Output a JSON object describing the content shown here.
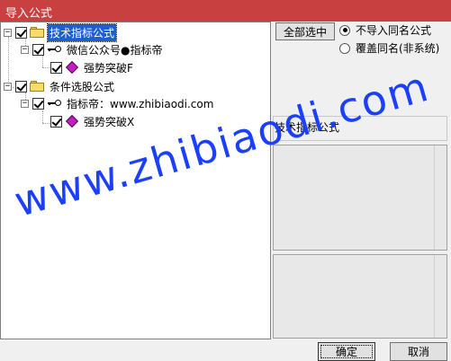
{
  "window": {
    "title": "导入公式"
  },
  "tree": {
    "nodes": [
      {
        "label": "技术指标公式",
        "expander": "−",
        "checked": true,
        "icon": "folder-icon",
        "selected": true
      },
      {
        "label": "微信公众号●指标帝",
        "expander": "−",
        "checked": true,
        "icon": "key-icon"
      },
      {
        "label": "强势突破F",
        "checked": true,
        "icon": "diamond-icon"
      },
      {
        "label": "条件选股公式",
        "expander": "−",
        "checked": true,
        "icon": "folder-icon"
      },
      {
        "label": "指标帝：www.zhibiaodi.com",
        "expander": "−",
        "checked": true,
        "icon": "key-icon"
      },
      {
        "label": "强势突破X",
        "checked": true,
        "icon": "diamond-icon"
      }
    ]
  },
  "buttons": {
    "select_all": "全部选中",
    "ok": "确定",
    "cancel": "取消"
  },
  "options": {
    "radio1": "不导入同名公式",
    "radio2": "覆盖同名(非系统)",
    "selected": "radio1"
  },
  "right_panel": {
    "type_label": "技术指标公式"
  },
  "watermark": {
    "text": "www.zhibiaodi.com"
  },
  "colors": {
    "titlebar": "#c94040",
    "selection": "#1e5fd0",
    "watermark": "#1a3fff"
  }
}
